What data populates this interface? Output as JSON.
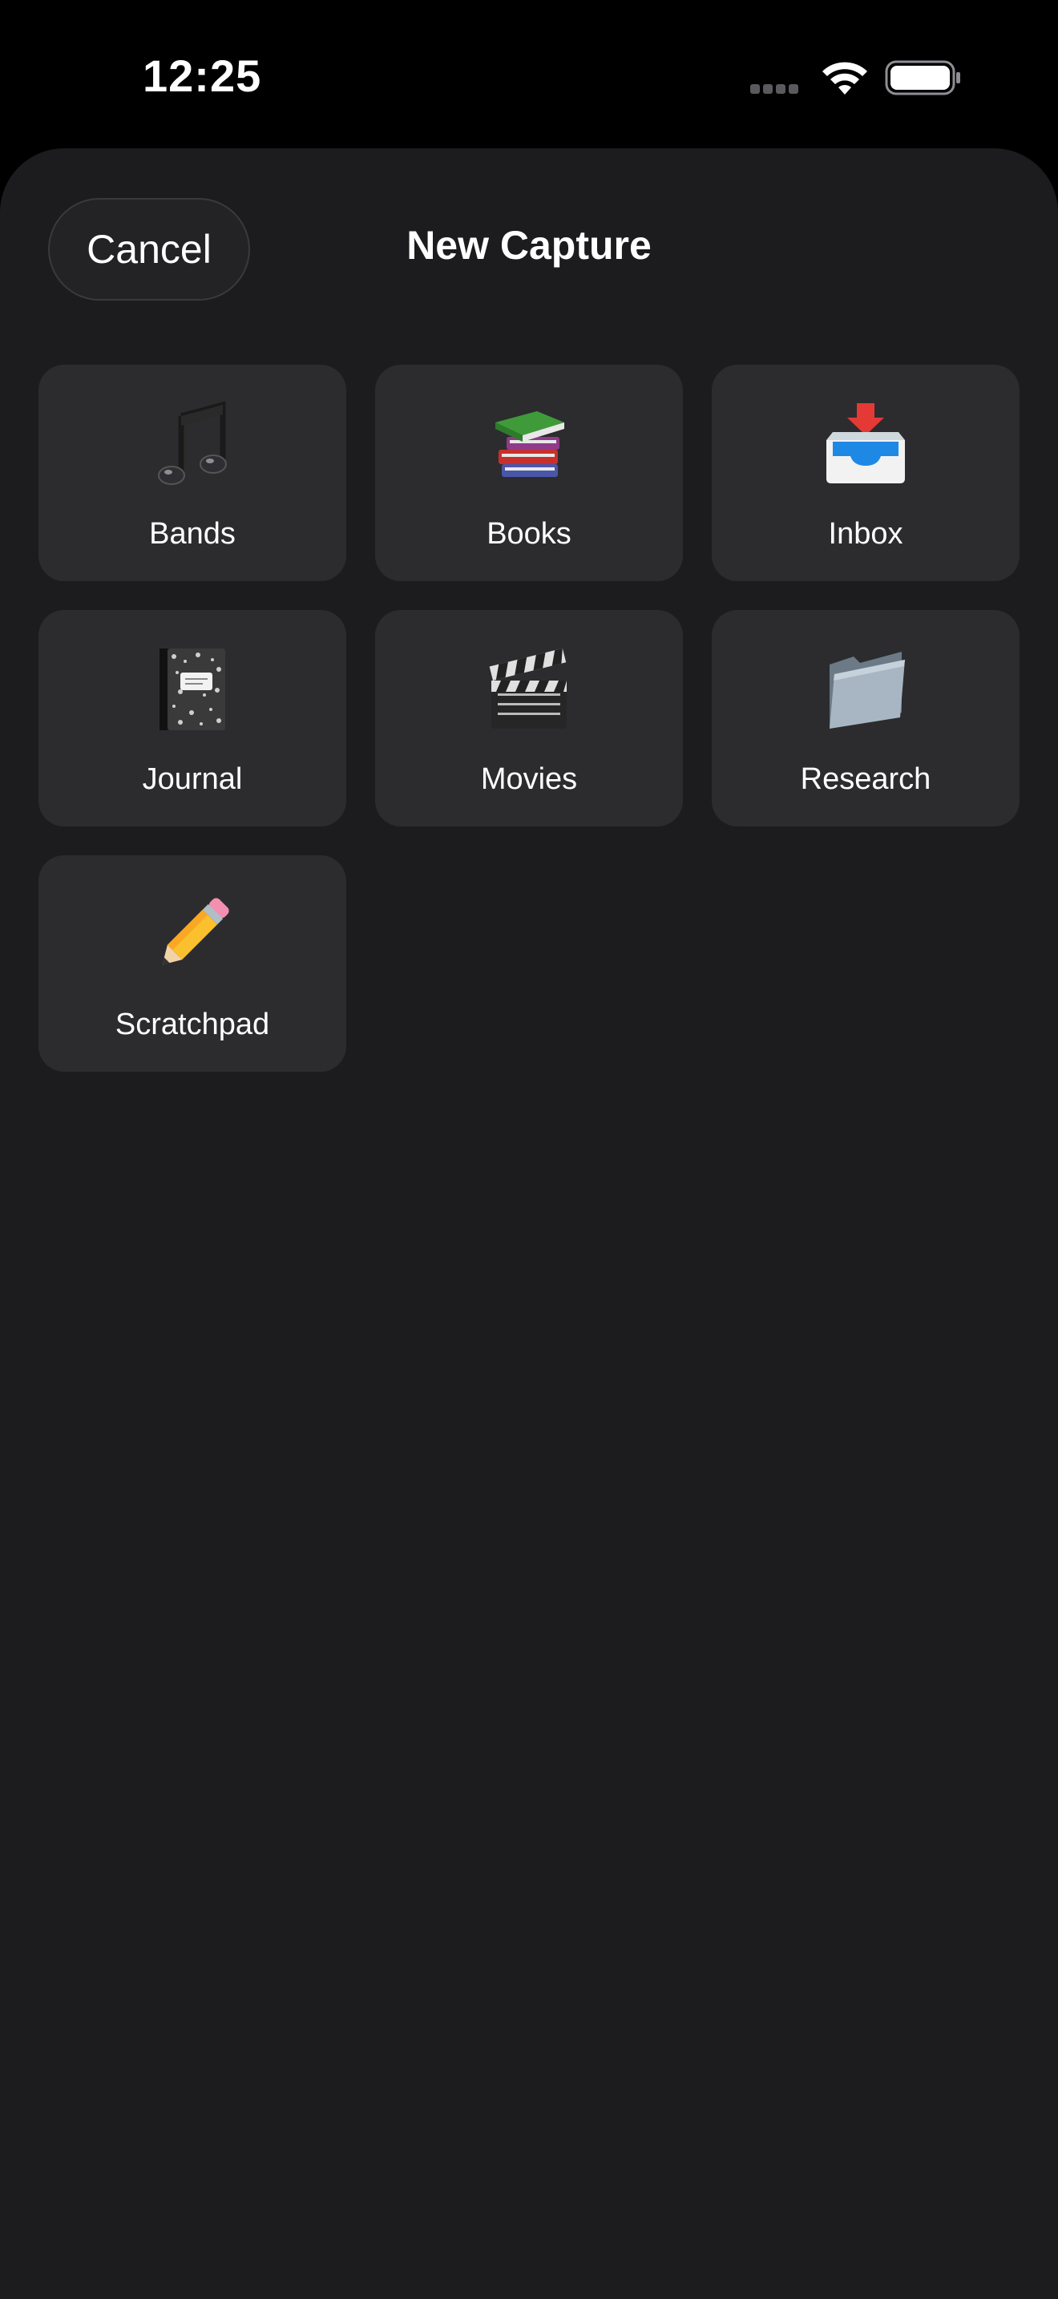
{
  "status_bar": {
    "time": "12:25",
    "signal_icon": "cellular-signal-dots-icon",
    "wifi_icon": "wifi-icon",
    "battery_icon": "battery-full-icon"
  },
  "sheet": {
    "title": "New Capture",
    "cancel_label": "Cancel"
  },
  "colors": {
    "background": "#000000",
    "sheet": "#1c1c1e",
    "tile": "#2c2c2e",
    "text": "#ffffff"
  },
  "tiles": [
    {
      "label": "Bands",
      "icon": "musical-notes-icon"
    },
    {
      "label": "Books",
      "icon": "stack-of-books-icon"
    },
    {
      "label": "Inbox",
      "icon": "inbox-tray-icon"
    },
    {
      "label": "Journal",
      "icon": "composition-notebook-icon"
    },
    {
      "label": "Movies",
      "icon": "clapper-board-icon"
    },
    {
      "label": "Research",
      "icon": "folder-icon"
    },
    {
      "label": "Scratchpad",
      "icon": "pencil-icon"
    }
  ]
}
